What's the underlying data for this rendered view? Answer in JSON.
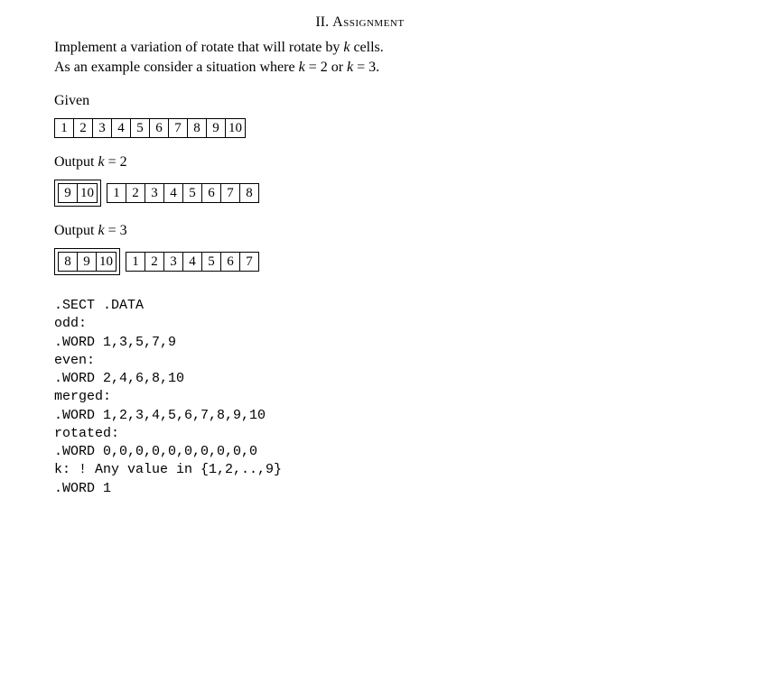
{
  "section": {
    "number": "II.",
    "title": "Assignment"
  },
  "intro": {
    "line1_a": "Implement a variation of rotate that will rotate by ",
    "line1_k": "k",
    "line1_b": " cells.",
    "line2_a": "As an example consider a situation where ",
    "line2_k1": "k",
    "line2_eq1": " = 2 or ",
    "line2_k2": "k",
    "line2_eq2": " = 3."
  },
  "given_label": "Given",
  "given": [
    "1",
    "2",
    "3",
    "4",
    "5",
    "6",
    "7",
    "8",
    "9",
    "10"
  ],
  "out2_label_a": "Output ",
  "out2_label_k": "k",
  "out2_label_b": " = 2",
  "out2_head": [
    "9",
    "10"
  ],
  "out2_tail": [
    "1",
    "2",
    "3",
    "4",
    "5",
    "6",
    "7",
    "8"
  ],
  "out3_label_a": "Output ",
  "out3_label_k": "k",
  "out3_label_b": " = 3",
  "out3_head": [
    "8",
    "9",
    "10"
  ],
  "out3_tail": [
    "1",
    "2",
    "3",
    "4",
    "5",
    "6",
    "7"
  ],
  "code": ".SECT .DATA\nodd:\n.WORD 1,3,5,7,9\neven:\n.WORD 2,4,6,8,10\nmerged:\n.WORD 1,2,3,4,5,6,7,8,9,10\nrotated:\n.WORD 0,0,0,0,0,0,0,0,0,0\nk: ! Any value in {1,2,..,9}\n.WORD 1"
}
